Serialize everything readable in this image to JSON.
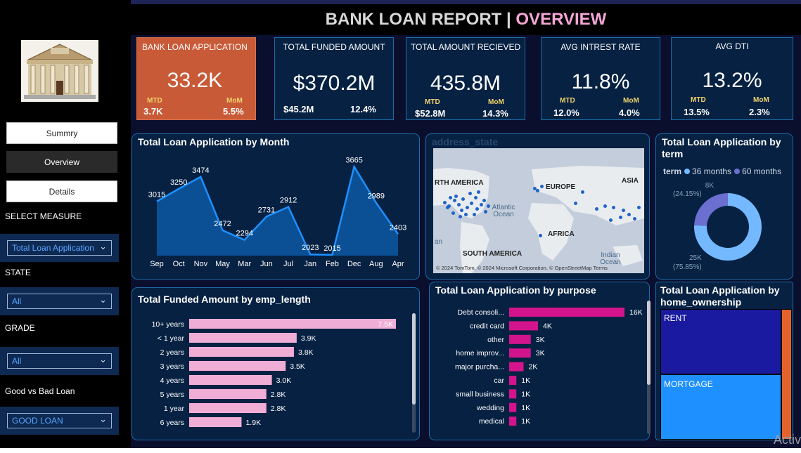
{
  "report": {
    "title_main": "BANK LOAN REPORT | ",
    "title_accent": "OVERVIEW"
  },
  "sidebar": {
    "nav": [
      {
        "label": "Summry"
      },
      {
        "label": "Overview"
      },
      {
        "label": "Details"
      }
    ],
    "filters": [
      {
        "label": "SELECT MEASURE",
        "value": "Total Loan Application"
      },
      {
        "label": "STATE",
        "value": "All"
      },
      {
        "label": "GRADE",
        "value": "All"
      },
      {
        "label": "Good vs Bad Loan",
        "value": "GOOD LOAN"
      }
    ]
  },
  "kpis": [
    {
      "title": "BANK LOAN APPLICATION",
      "value": "33.2K",
      "mtd_label": "MTD",
      "mtd": "3.7K",
      "mom_label": "MoM",
      "mom": "5.5%"
    },
    {
      "title": "TOTAL FUNDED AMOUNT",
      "value": "$370.2M",
      "mtd_label": "",
      "mtd": "$45.2M",
      "mom_label": "",
      "mom": "12.4%"
    },
    {
      "title": "TOTAL AMOUNT RECIEVED",
      "value": "435.8M",
      "mtd_label": "MTD",
      "mtd": "$52.8M",
      "mom_label": "MoM",
      "mom": "14.3%"
    },
    {
      "title": "AVG INTREST RATE",
      "value": "11.8%",
      "mtd_label": "MTD",
      "mtd": "12.0%",
      "mom_label": "MoM",
      "mom": "4.0%"
    },
    {
      "title": "AVG DTI",
      "value": "13.2%",
      "mtd_label": "MTD",
      "mtd": "13.5%",
      "mom_label": "MoM",
      "mom": "2.3%"
    }
  ],
  "month_chart": {
    "title": "Total Loan Application by Month"
  },
  "map": {
    "title": "address_state",
    "labels": {
      "na": "RTH AMERICA",
      "europe": "EUROPE",
      "asia": "ASIA",
      "atlantic": "Atlantic\nOcean",
      "africa": "AFRICA",
      "sa": "SOUTH AMERICA",
      "indian": "Indian\nOcean",
      "an": "an"
    },
    "credit": "© 2024 TomTom, © 2024 Microsoft Corporation, © OpenStreetMap  Terms"
  },
  "term_chart": {
    "title": "Total Loan Application by term",
    "legend_title": "term",
    "legend": [
      "36 months",
      "60 months"
    ],
    "labels": [
      {
        "value": "8K",
        "pct": "(24.15%)"
      },
      {
        "value": "25K",
        "pct": "(75.85%)"
      }
    ]
  },
  "emp_chart": {
    "title": "Total Funded Amount by emp_length"
  },
  "purpose_chart": {
    "title": "Total Loan Application by purpose"
  },
  "home_chart": {
    "title": "Total Loan Application by home_ownership",
    "labels": [
      "RENT",
      "MORTGAGE"
    ]
  },
  "watermark": "Activ",
  "colors": {
    "accent_pink": "#f5a6d6",
    "kpi_orange": "#c85a37",
    "line": "#1e90ff",
    "emp_bar": "#f0aed6",
    "purpose_bar": "#d4148c",
    "rent": "#1a1aa0",
    "mortgage": "#1e90ff",
    "own": "#e4622e"
  },
  "chart_data": [
    {
      "type": "area",
      "title": "Total Loan Application by Month",
      "categories": [
        "Sep",
        "Oct",
        "Nov",
        "May",
        "Mar",
        "Jun",
        "Jul",
        "Jan",
        "Feb",
        "Dec",
        "Aug",
        "Apr"
      ],
      "values": [
        3015,
        3250,
        3474,
        2472,
        2294,
        2731,
        2912,
        2023,
        2015,
        3665,
        2989,
        2403
      ],
      "ylim": [
        2000,
        3800
      ]
    },
    {
      "type": "pie",
      "title": "Total Loan Application by term",
      "categories": [
        "36 months",
        "60 months"
      ],
      "values": [
        25,
        8
      ],
      "value_labels": [
        "25K",
        "8K"
      ],
      "percents": [
        75.85,
        24.15
      ]
    },
    {
      "type": "bar",
      "title": "Total Funded Amount by emp_length",
      "categories": [
        "10+ years",
        "< 1 year",
        "2 years",
        "3 years",
        "4 years",
        "5 years",
        "1 year",
        "6 years"
      ],
      "values": [
        7.5,
        3.9,
        3.8,
        3.5,
        3.0,
        2.8,
        2.8,
        1.9
      ],
      "value_labels": [
        "7.5K",
        "3.9K",
        "3.8K",
        "3.5K",
        "3.0K",
        "2.8K",
        "2.8K",
        "1.9K"
      ]
    },
    {
      "type": "bar",
      "title": "Total Loan Application by purpose",
      "categories": [
        "Debt consoli...",
        "credit card",
        "other",
        "home improv...",
        "major purcha...",
        "car",
        "small business",
        "wedding",
        "medical"
      ],
      "values": [
        16,
        4,
        3,
        3,
        2,
        1,
        1,
        1,
        1
      ],
      "value_labels": [
        "16K",
        "4K",
        "3K",
        "3K",
        "2K",
        "1K",
        "1K",
        "1K",
        "1K"
      ]
    }
  ]
}
